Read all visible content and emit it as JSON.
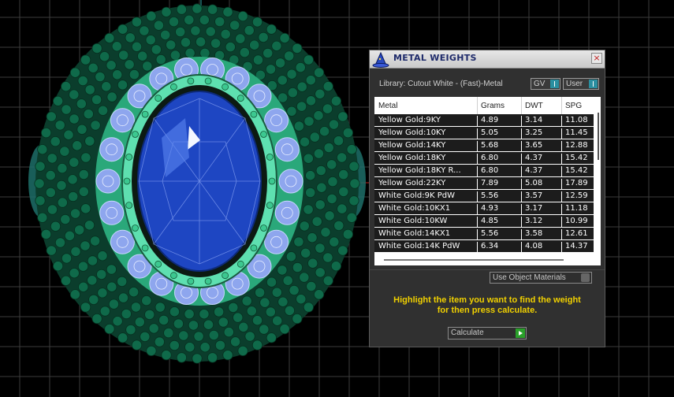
{
  "panel": {
    "title": "METAL WEIGHTS",
    "close_label": "×",
    "library_label": "Library: Cutout White - (Fast)-Metal",
    "toggles": [
      {
        "label": "GV"
      },
      {
        "label": "User"
      }
    ],
    "table": {
      "columns": [
        "Metal",
        "Grams",
        "DWT",
        "SPG"
      ],
      "rows": [
        [
          "Yellow Gold:9KY",
          "4.89",
          "3.14",
          "11.08"
        ],
        [
          "Yellow Gold:10KY",
          "5.05",
          "3.25",
          "11.45"
        ],
        [
          "Yellow Gold:14KY",
          "5.68",
          "3.65",
          "12.88"
        ],
        [
          "Yellow Gold:18KY",
          "6.80",
          "4.37",
          "15.42"
        ],
        [
          "Yellow Gold:18KY R...",
          "6.80",
          "4.37",
          "15.42"
        ],
        [
          "Yellow Gold:22KY",
          "7.89",
          "5.08",
          "17.89"
        ],
        [
          "White Gold:9K PdW",
          "5.56",
          "3.57",
          "12.59"
        ],
        [
          "White Gold:10KX1",
          "4.93",
          "3.17",
          "11.18"
        ],
        [
          "White Gold:10KW",
          "4.85",
          "3.12",
          "10.99"
        ],
        [
          "White Gold:14KX1",
          "5.56",
          "3.58",
          "12.61"
        ],
        [
          "White Gold:14K PdW",
          "6.34",
          "4.08",
          "14.37"
        ]
      ]
    },
    "material_dropdown": "Use Object Materials",
    "instruction_line1": "Highlight the item you want to find the weight",
    "instruction_line2": "for then press calculate.",
    "calculate_label": "Calculate"
  },
  "viewport": {
    "grid_color": "#3c3c3c",
    "bead_color": "#0f6a4a",
    "gem_color": "#1a3fb0",
    "diamond_color": "#8ea6ee"
  }
}
